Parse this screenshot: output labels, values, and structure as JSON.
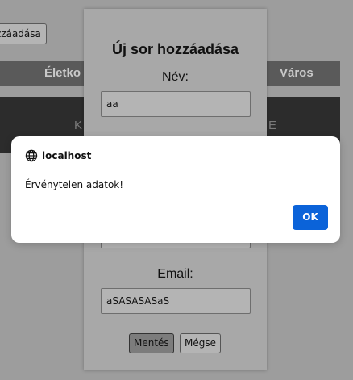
{
  "background": {
    "add_button_label": "zzáadása",
    "table_headers": [
      "Életko",
      "Város"
    ],
    "row_cells": [
      "K",
      "E"
    ]
  },
  "modal": {
    "title": "Új sor hozzáadása",
    "name_label": "Név:",
    "name_value": "aa",
    "email_label": "Email:",
    "email_value": "aSASASASaS",
    "save_label": "Mentés",
    "cancel_label": "Mégse"
  },
  "alert": {
    "origin": "localhost",
    "message": "Érvénytelen adatok!",
    "ok_label": "OK",
    "icon": "globe-icon",
    "accent_color": "#0b63d9"
  }
}
